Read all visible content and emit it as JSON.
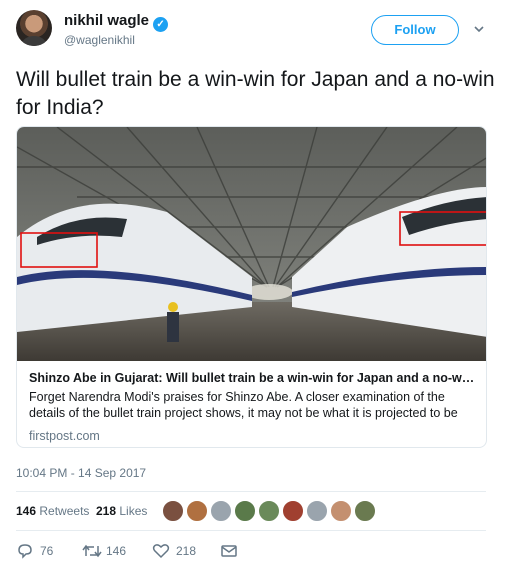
{
  "author": {
    "name": "nikhil wagle",
    "handle": "@waglenikhil",
    "verified_glyph": "✓"
  },
  "follow_label": "Follow",
  "tweet_text": "Will bullet train be a win-win for Japan and a no-win for India?",
  "card": {
    "title": "Shinzo Abe in Gujarat: Will bullet train be a win-win for Japan and a no-win ...",
    "description": "Forget Narendra Modi's praises for Shinzo Abe. A closer examination of the details of the bullet train project shows, it may not be what it is projected to be",
    "domain": "firstpost.com"
  },
  "timestamp": "10:04 PM - 14 Sep 2017",
  "stats": {
    "retweets_count": "146",
    "retweets_label": "Retweets",
    "likes_count": "218",
    "likes_label": "Likes"
  },
  "actions": {
    "reply_count": "76",
    "retweet_count": "146",
    "like_count": "218"
  },
  "colors": {
    "accent": "#1da1f2",
    "muted": "#657786"
  },
  "icons": [
    "verified-icon",
    "chevron-down-icon",
    "reply-icon",
    "retweet-icon",
    "like-icon",
    "direct-message-icon"
  ]
}
